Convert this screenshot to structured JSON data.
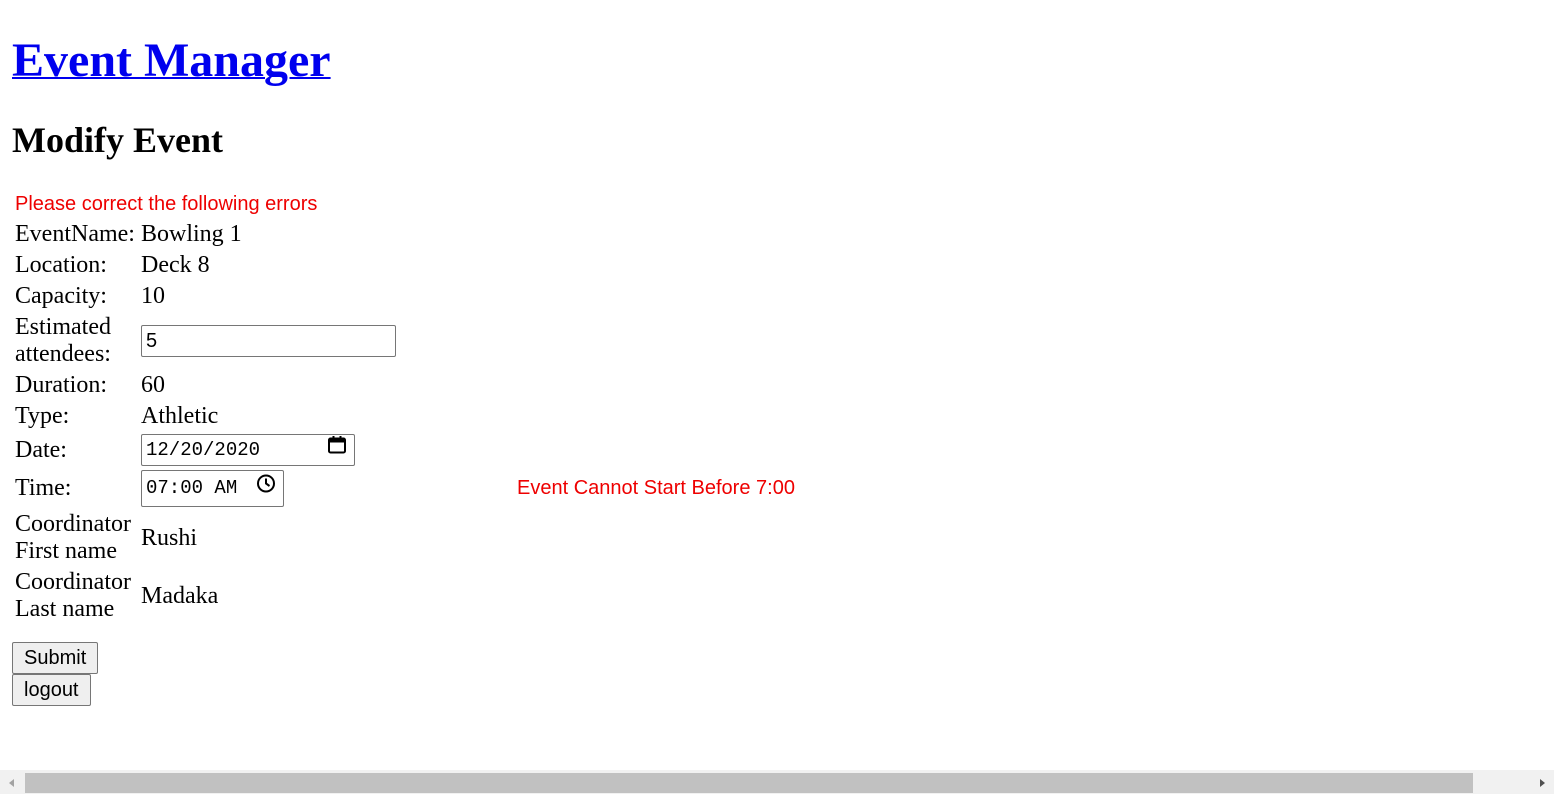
{
  "header": {
    "site_title": "Event Manager",
    "page_title": "Modify Event"
  },
  "errors": {
    "summary": "Please correct the following errors",
    "time_error": "Event Cannot Start Before 7:00"
  },
  "form": {
    "event_name_label": "EventName:",
    "event_name_value": "Bowling 1",
    "location_label": "Location:",
    "location_value": "Deck 8",
    "capacity_label": "Capacity:",
    "capacity_value": "10",
    "attendees_label": "Estimated attendees:",
    "attendees_value": "5",
    "duration_label": "Duration:",
    "duration_value": "60",
    "type_label": "Type:",
    "type_value": "Athletic",
    "date_label": "Date:",
    "date_value": "12/20/2020",
    "time_label": "Time:",
    "time_value": "07:00 AM",
    "coord_first_label": "Coordinator First name",
    "coord_first_value": "Rushi",
    "coord_last_label": "Coordinator Last name",
    "coord_last_value": "Madaka"
  },
  "buttons": {
    "submit_label": "Submit",
    "logout_label": "logout"
  },
  "colors": {
    "link": "#0000ee",
    "error": "#ee0000"
  },
  "icons": {
    "date": "calendar-icon",
    "time": "clock-icon"
  }
}
